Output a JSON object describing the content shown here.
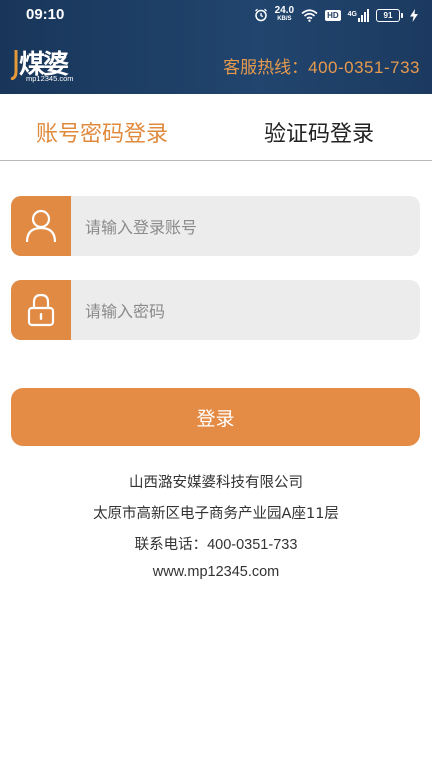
{
  "status_bar": {
    "time": "09:10",
    "net_speed_value": "24.0",
    "net_speed_unit": "KB/S",
    "hd_badge": "HD",
    "network_type": "4G",
    "battery": "91"
  },
  "header": {
    "logo_text": "煤婆",
    "logo_url": "mp12345.com",
    "hotline_label": "客服热线：",
    "hotline_number": "400-0351-733"
  },
  "tabs": [
    {
      "label": "账号密码登录",
      "active": true
    },
    {
      "label": "验证码登录",
      "active": false
    }
  ],
  "form": {
    "account_placeholder": "请输入登录账号",
    "password_placeholder": "请输入密码",
    "login_label": "登录"
  },
  "company": {
    "name": "山西潞安媒婆科技有限公司",
    "address": "太原市高新区电子商务产业园A座11层",
    "phone_label": "联系电话：",
    "phone": "400-0351-733",
    "website": "www.mp12345.com"
  },
  "colors": {
    "header_bg": "#1f3e64",
    "accent": "#e08a44",
    "field_bg": "#ececec"
  }
}
